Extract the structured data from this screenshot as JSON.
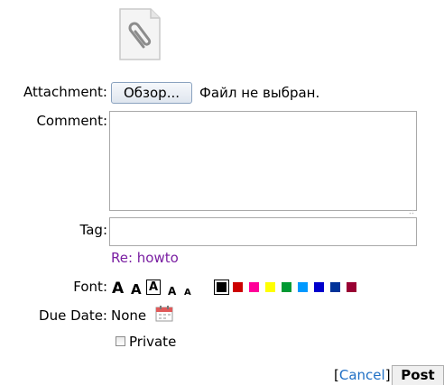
{
  "attachment": {
    "label": "Attachment:",
    "browse_label": "Обзор...",
    "status": "Файл не выбран."
  },
  "comment": {
    "label": "Comment:",
    "value": ""
  },
  "tag": {
    "label": "Tag:",
    "value": "",
    "suggestion": "Re: howto"
  },
  "font": {
    "label": "Font:",
    "size_options": [
      "A",
      "A",
      "A",
      "A",
      "A"
    ],
    "colors": [
      "#000000",
      "#cc0000",
      "#ff0099",
      "#ffff00",
      "#009933",
      "#0099ff",
      "#0000cc",
      "#003399",
      "#990033"
    ],
    "selected_color": "#000000"
  },
  "due_date": {
    "label": "Due Date:",
    "value": "None"
  },
  "private": {
    "label": "Private",
    "checked": false
  },
  "actions": {
    "bracket_open": "[",
    "cancel_label": "Cancel",
    "bracket_close": "]",
    "post_label": "Post"
  },
  "icons": {
    "attachment": "paperclip-icon",
    "calendar": "calendar-icon"
  }
}
